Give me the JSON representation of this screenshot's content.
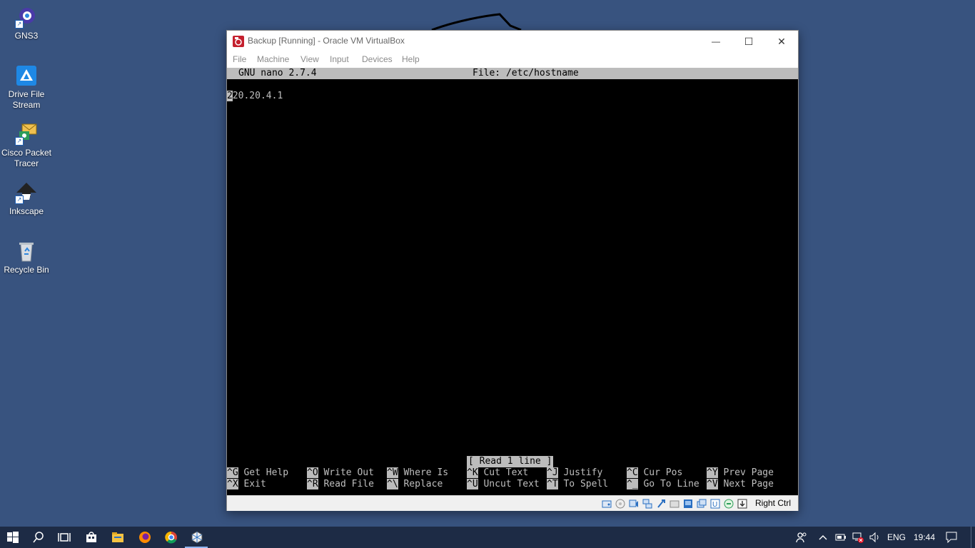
{
  "desktop": {
    "icons": [
      {
        "label": "GNS3",
        "icon": "gns3-icon"
      },
      {
        "label": "Drive File Stream",
        "icon": "drive-icon"
      },
      {
        "label": "Cisco Packet Tracer",
        "icon": "packet-tracer-icon"
      },
      {
        "label": "Inkscape",
        "icon": "inkscape-icon"
      },
      {
        "label": "Recycle Bin",
        "icon": "recycle-bin-icon"
      }
    ]
  },
  "window": {
    "title": "Backup [Running] - Oracle VM VirtualBox",
    "menu": [
      "File",
      "Machine",
      "View",
      "Input",
      "Devices",
      "Help"
    ],
    "controls": {
      "minimize": "—",
      "maximize": "☐",
      "close": "✕"
    }
  },
  "nano": {
    "version": "GNU nano 2.7.4",
    "file": "File: /etc/hostname",
    "cursor_char": "2",
    "content_rest": "20.20.4.1",
    "status": "[ Read 1 line ]",
    "shortcuts_row1": [
      {
        "key": "^G",
        "label": "Get Help"
      },
      {
        "key": "^O",
        "label": "Write Out"
      },
      {
        "key": "^W",
        "label": "Where Is"
      },
      {
        "key": "^K",
        "label": "Cut Text"
      },
      {
        "key": "^J",
        "label": "Justify"
      },
      {
        "key": "^C",
        "label": "Cur Pos"
      },
      {
        "key": "^Y",
        "label": "Prev Page"
      }
    ],
    "shortcuts_row2": [
      {
        "key": "^X",
        "label": "Exit"
      },
      {
        "key": "^R",
        "label": "Read File"
      },
      {
        "key": "^\\",
        "label": "Replace"
      },
      {
        "key": "^U",
        "label": "Uncut Text"
      },
      {
        "key": "^T",
        "label": "To Spell"
      },
      {
        "key": "^_",
        "label": "Go To Line"
      },
      {
        "key": "^V",
        "label": "Next Page"
      }
    ]
  },
  "statusbar": {
    "host_key": "Right Ctrl",
    "icons": [
      "hard-disk-icon",
      "optical-drive-icon",
      "audio-icon",
      "network-icon",
      "usb-icon",
      "shared-folders-icon",
      "display-icon",
      "video-capture-icon",
      "recording-icon",
      "cpu-icon",
      "mouse-integration-icon",
      "keyboard-icon"
    ]
  },
  "taskbar": {
    "apps": [
      "start-icon",
      "search-icon",
      "task-view-icon",
      "store-icon",
      "file-explorer-icon",
      "firefox-icon",
      "chrome-icon",
      "virtualbox-icon"
    ],
    "language": "ENG",
    "time": "19:44"
  },
  "colors": {
    "desktop_bg": "#38537f",
    "taskbar_bg": "#1d2b45",
    "terminal_bg": "#000000",
    "nano_bar": "#bcbcbc"
  }
}
